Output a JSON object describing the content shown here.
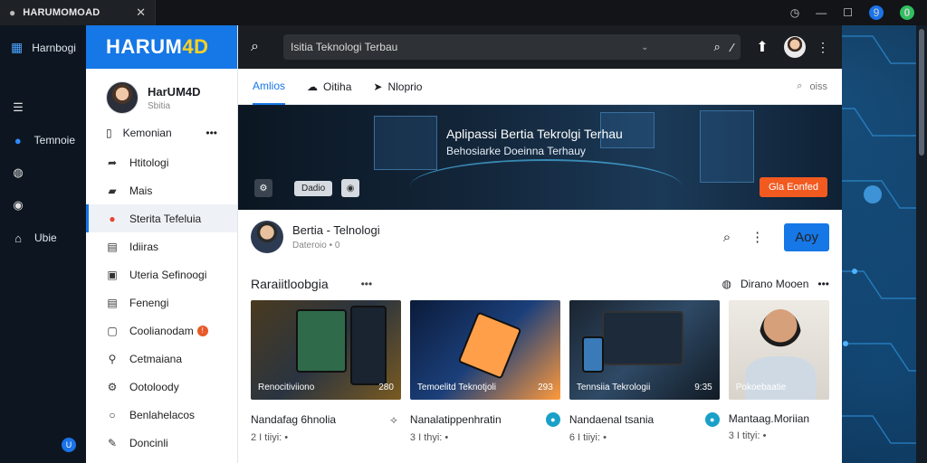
{
  "browser": {
    "tab_title": "HARUMOMOAD",
    "icons": [
      "history-icon",
      "minimize-icon",
      "maximize-icon",
      "close-icon"
    ],
    "badge_blue": "9",
    "badge_green": "0"
  },
  "rail": {
    "title": "Harnbogi",
    "items": [
      {
        "label": "",
        "icon": "menu-icon"
      },
      {
        "label": "Temnoie",
        "icon": "info-icon"
      },
      {
        "label": "",
        "icon": "globe-icon"
      },
      {
        "label": "",
        "icon": "compass-icon"
      },
      {
        "label": "Ubie",
        "icon": "home-icon"
      }
    ],
    "bottom_badge": "U"
  },
  "sidebar": {
    "brand_main": "HARUM",
    "brand_accent": "4D",
    "profile_name": "HarUM4D",
    "profile_sub": "Sbitia",
    "menu_head": "Kemonian",
    "items": [
      {
        "label": "Htitologi"
      },
      {
        "label": "Mais"
      },
      {
        "label": "Sterita Tefeluia"
      },
      {
        "label": "Idiiras"
      },
      {
        "label": "Uteria Sefinoogi"
      },
      {
        "label": "Fenengi"
      },
      {
        "label": "Coolianodam"
      },
      {
        "label": "Cetmaiana"
      },
      {
        "label": "Ootoloody"
      },
      {
        "label": "Benlahelacos"
      },
      {
        "label": "Doncinli"
      }
    ],
    "badge": "!"
  },
  "search": {
    "value": "Isitia Teknologi Terbau"
  },
  "tabs": [
    {
      "label": "Amlios"
    },
    {
      "label": "Oitiha"
    },
    {
      "label": "Nloprio"
    }
  ],
  "tabs_right": "oiss",
  "hero": {
    "title": "Aplipassi Bertia Tekrolgi Terhau",
    "subtitle": "Behosiarke Doeinna Terhauy",
    "btn_small": "Dadio",
    "cta": "Gla Eonfed"
  },
  "channel": {
    "name": "Bertia - Telnologi",
    "sub": "Dateroio • 0",
    "apply": "Aoy"
  },
  "section": {
    "title": "Raraiitloobgia",
    "right_label": "Dirano Mooen"
  },
  "cards": [
    {
      "caption": "Renocitiviiono",
      "count": "280",
      "title": "Nandafag 6hnolia",
      "meta": "2 I tiiyi: •"
    },
    {
      "caption": "Temoelitd Teknotjoli",
      "count": "293",
      "title": "Nanalatippenhratin",
      "meta": "3 I thyi: •"
    },
    {
      "caption": "Tennsiia Tekrologii",
      "count": "9:35",
      "title": "Nandaenal tsania",
      "meta": "6 I tiiyi: •"
    },
    {
      "caption": "Pokoebaatie",
      "count": "",
      "title": "Mantaag.Moriian",
      "meta": "3 I tityi: •"
    }
  ]
}
